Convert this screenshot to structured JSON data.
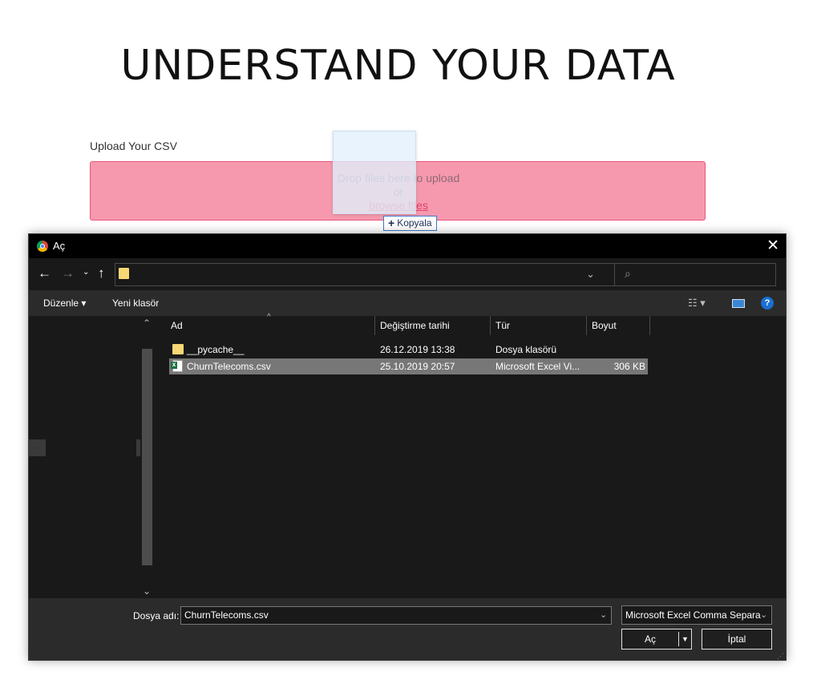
{
  "page": {
    "title": "UNDERSTAND YOUR DATA",
    "upload_label": "Upload Your CSV",
    "dropzone": {
      "line1": "Drop files here to upload",
      "line2": "or",
      "browse_link": "browse files"
    },
    "drag_tooltip": {
      "plus": "+",
      "label": "Kopyala"
    }
  },
  "dialog": {
    "title": "Aç",
    "close": "✕",
    "nav": {
      "back": "←",
      "forward": "→",
      "recent": "⌄",
      "up": "↑",
      "address_chevron": "⌄",
      "refresh": "↻",
      "search_icon": "⌕"
    },
    "toolbar": {
      "organize": "Düzenle ▾",
      "new_folder": "Yeni klasör",
      "view": "☷ ▾",
      "help": "?"
    },
    "columns": {
      "name": "Ad",
      "modified": "Değiştirme tarihi",
      "type": "Tür",
      "size": "Boyut"
    },
    "files": [
      {
        "name": "__pycache__",
        "modified": "26.12.2019 13:38",
        "type": "Dosya klasörü",
        "size": "",
        "icon": "folder-icon",
        "selected": false
      },
      {
        "name": "ChurnTelecoms.csv",
        "modified": "25.10.2019 20:57",
        "type": "Microsoft Excel Vi...",
        "size": "306 KB",
        "icon": "excel-csv-icon",
        "selected": true
      }
    ],
    "footer": {
      "filename_label": "Dosya adı:",
      "filename_value": "ChurnTelecoms.csv",
      "filter": "Microsoft Excel Comma Separa",
      "open_button": "Aç",
      "cancel_button": "İptal"
    }
  }
}
